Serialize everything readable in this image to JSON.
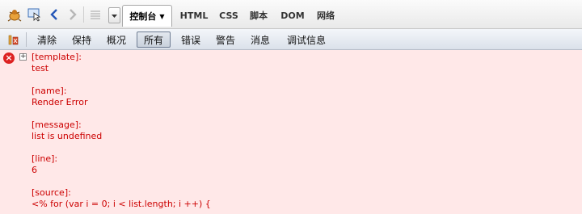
{
  "toolbar": {
    "icons": [
      "firebug-icon",
      "inspect-icon",
      "back-icon",
      "forward-icon",
      "list-icon",
      "dropdown-mini-icon"
    ],
    "tabs": [
      {
        "label": "控制台"
      },
      {
        "label": "HTML"
      },
      {
        "label": "CSS"
      },
      {
        "label": "脚本"
      },
      {
        "label": "DOM"
      },
      {
        "label": "网络"
      }
    ]
  },
  "console_bar": {
    "buttons": [
      {
        "label": "清除"
      },
      {
        "label": "保持"
      },
      {
        "label": "概况"
      },
      {
        "label": "所有"
      },
      {
        "label": "错误"
      },
      {
        "label": "警告"
      },
      {
        "label": "消息"
      },
      {
        "label": "调试信息"
      }
    ]
  },
  "log": {
    "error_message": "[template]:\ntest\n\n[name]:\nRender Error\n\n[message]:\nlist is undefined\n\n[line]:\n6\n\n[source]:\n<% for (var i = 0; i < list.length; i ++) {",
    "colors": {
      "error_bg": "#ffe8e8",
      "error_text": "#cc0000"
    }
  }
}
